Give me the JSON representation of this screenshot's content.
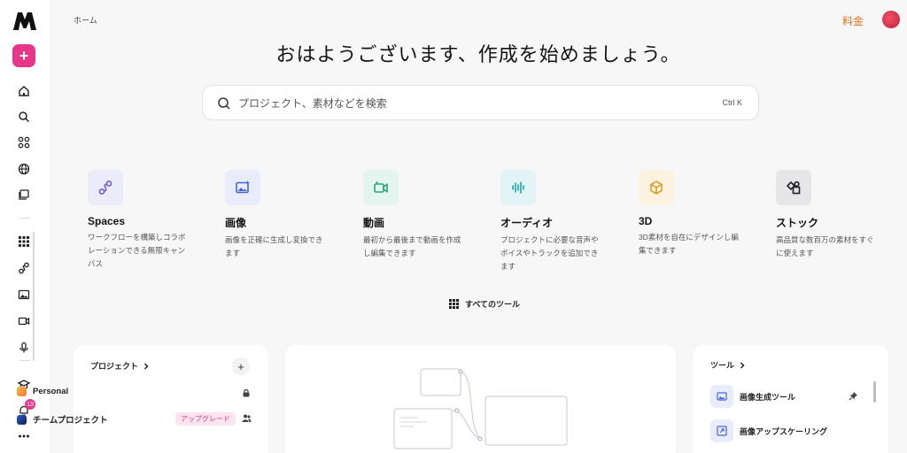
{
  "header": {
    "breadcrumb": "ホーム",
    "pricing": "料金",
    "greeting": "おはようございます、作成を始めましょう。"
  },
  "sidebar": {
    "create_icon": "plus-icon",
    "items": [
      "home-icon",
      "search-icon",
      "apps-icon",
      "globe-icon",
      "library-icon",
      "grid-icon",
      "spaces-icon",
      "image-icon",
      "video-icon",
      "mic-icon",
      "learn-icon",
      "bell-icon",
      "more-icon"
    ],
    "notification_count": "13"
  },
  "search": {
    "placeholder": "プロジェクト、素材などを検索",
    "shortcut": "Ctrl K"
  },
  "tools": [
    {
      "name": "Spaces",
      "desc": "ワークフローを構築しコラボレーションできる無限キャンバス",
      "icon": "spaces-icon",
      "bg": "#ecebfa",
      "color": "#6e5bd6"
    },
    {
      "name": "画像",
      "desc": "画像を正確に生成し変換できます",
      "icon": "image-icon",
      "bg": "#e9ecfb",
      "color": "#4664d8"
    },
    {
      "name": "動画",
      "desc": "最初から最後まで動画を作成し編集できます",
      "icon": "video-icon",
      "bg": "#e3f5ee",
      "color": "#22a979"
    },
    {
      "name": "オーディオ",
      "desc": "プロジェクトに必要な音声やボイスやトラックを追加できます",
      "icon": "audio-icon",
      "bg": "#e2f4f5",
      "color": "#22a6b0"
    },
    {
      "name": "3D",
      "desc": "3D素材を自在にデザインし編集できます",
      "icon": "cube-icon",
      "bg": "#fbf2df",
      "color": "#d9a12a"
    },
    {
      "name": "ストック",
      "desc": "高品質な数百万の素材をすぐに使えます",
      "icon": "stock-icon",
      "bg": "#e6e6e8",
      "color": "#222222"
    }
  ],
  "all_tools_label": "すべてのツール",
  "projects": {
    "title": "プロジェクト",
    "items": [
      {
        "name": "Personal"
      },
      {
        "name": "チームプロジェクト",
        "badge": "アップグレード"
      }
    ]
  },
  "tools_card": {
    "title": "ツール",
    "items": [
      "画像生成ツール",
      "画像アップスケーリング"
    ]
  }
}
